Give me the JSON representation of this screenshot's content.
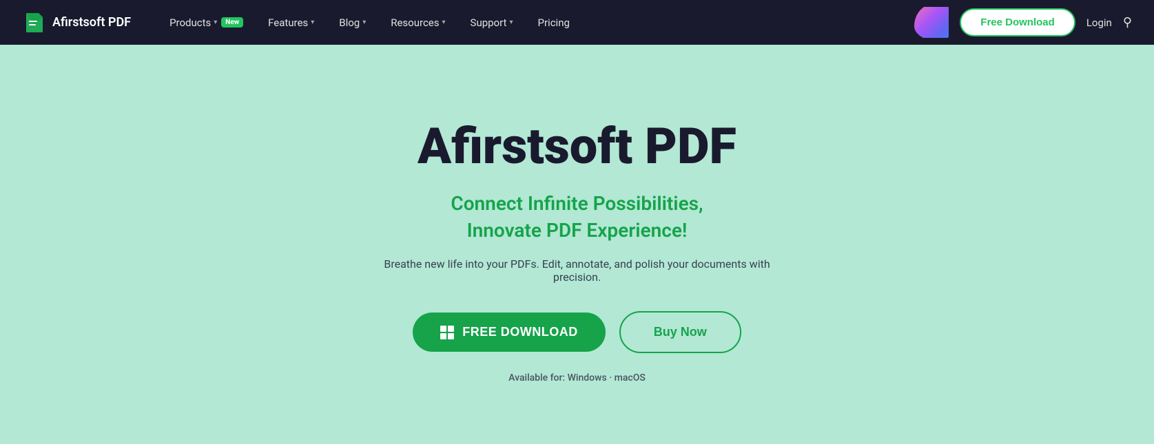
{
  "brand": {
    "name": "Afirstsoft PDF",
    "logo_alt": "Afirstsoft PDF Logo"
  },
  "nav": {
    "items": [
      {
        "label": "Products",
        "has_dropdown": true,
        "badge": "New"
      },
      {
        "label": "Features",
        "has_dropdown": true,
        "badge": null
      },
      {
        "label": "Blog",
        "has_dropdown": true,
        "badge": null
      },
      {
        "label": "Resources",
        "has_dropdown": true,
        "badge": null
      },
      {
        "label": "Support",
        "has_dropdown": true,
        "badge": null
      },
      {
        "label": "Pricing",
        "has_dropdown": false,
        "badge": null
      }
    ],
    "cta_label": "Free Download",
    "login_label": "Login",
    "search_label": "Search"
  },
  "hero": {
    "title": "Afirstsoft PDF",
    "subtitle_line1": "Connect Infinite Possibilities,",
    "subtitle_line2": "Innovate PDF Experience!",
    "description": "Breathe new life into your PDFs. Edit, annotate, and polish your documents with precision.",
    "download_btn_label": "FREE DOWNLOAD",
    "buy_btn_label": "Buy Now",
    "available_text": "Available for: Windows · macOS"
  }
}
